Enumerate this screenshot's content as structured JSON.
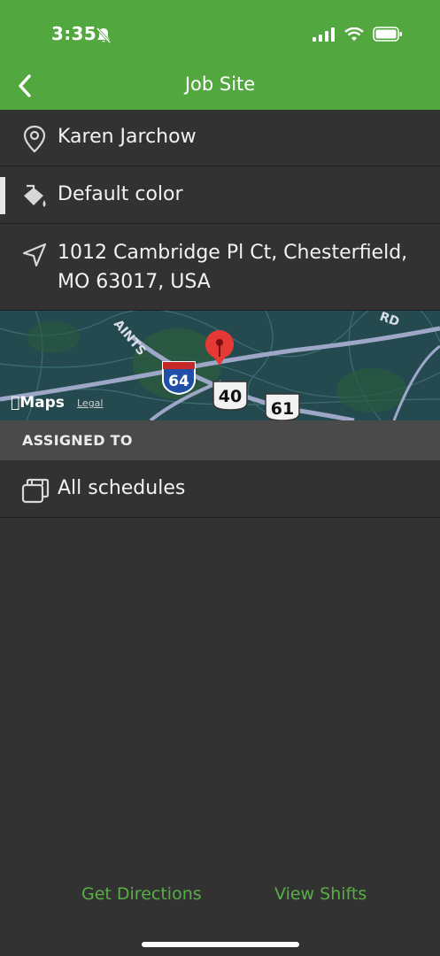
{
  "status_bar": {
    "time": "3:35"
  },
  "nav": {
    "title": "Job Site"
  },
  "details": {
    "name": "Karen Jarchow",
    "color_label": "Default color",
    "address_line1": "1012 Cambridge Pl Ct, Chesterfield,",
    "address_line2": "MO 63017, USA"
  },
  "map": {
    "attribution": "Maps",
    "legal": "Legal",
    "road_labels": [
      "64",
      "40",
      "61",
      "AINTS",
      "RD"
    ],
    "pin_color": "#e53935"
  },
  "assigned": {
    "header": "ASSIGNED TO",
    "schedules_label": "All schedules"
  },
  "actions": {
    "directions": "Get Directions",
    "shifts": "View Shifts"
  },
  "colors": {
    "brand": "#52a83f",
    "background": "#323232",
    "link": "#58ae45"
  }
}
